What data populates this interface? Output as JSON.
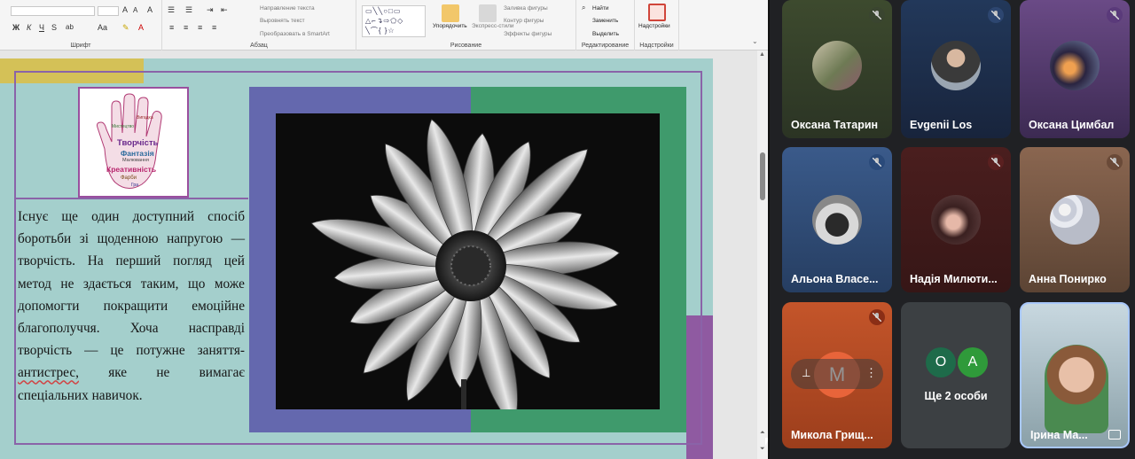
{
  "ribbon": {
    "font_group": "Шрифт",
    "paragraph_group": "Абзац",
    "drawing_group": "Рисование",
    "editing_group": "Редактирование",
    "addins_group": "Надстройки",
    "text_direction": "Направление текста",
    "align_text": "Выровнять текст",
    "smartart": "Преобразовать в SmartArt",
    "arrange": "Упорядочить",
    "quick_styles": "Экспресс-стили",
    "shape_fill": "Заливка фигуры",
    "shape_outline": "Контур фигуры",
    "shape_effects": "Эффекты фигуры",
    "find": "Найти",
    "replace": "Заменить",
    "select": "Выделить",
    "addins_button": "Надстройки"
  },
  "slide": {
    "lines": [
      "Існує ще один доступний спосіб",
      "боротьби зі щоденною напругою —",
      "творчість. На перший погляд цей",
      "метод не здається таким, що може",
      "допомогти покращити емоційне",
      "благополуччя. Хоча насправді",
      "творчість — це потужне заняття-",
      "антистрес, яке не вимагає",
      "спеціальних навичок."
    ],
    "wordcloud": [
      "Творчість",
      "Фантазія",
      "Креативність",
      "Фарби",
      "Мистецтво",
      "Малювання",
      "Вигадка",
      "Гра"
    ]
  },
  "participants": [
    {
      "name": "Оксана Татарин",
      "mic": "muted"
    },
    {
      "name": "Evgenii Los",
      "mic": "muted"
    },
    {
      "name": "Оксана Цимбал",
      "mic": "muted"
    },
    {
      "name": "Альона Власе...",
      "mic": "muted"
    },
    {
      "name": "Надія Милюти...",
      "mic": "muted"
    },
    {
      "name": "Анна Понирко",
      "mic": "muted"
    },
    {
      "name": "Микола Грищ...",
      "initial": "M",
      "mic": "muted"
    },
    {
      "name": "Ще 2 особи",
      "initials": [
        "О",
        "А"
      ]
    },
    {
      "name": "Ірина Ма...",
      "mic": "on"
    }
  ],
  "colors": {
    "slide_bg": "#a4cfcc",
    "yellow": "#d4c157",
    "purple": "#6468ae",
    "green": "#3f9a6c",
    "frame": "#8a63a8",
    "meet_bg": "#202124"
  }
}
